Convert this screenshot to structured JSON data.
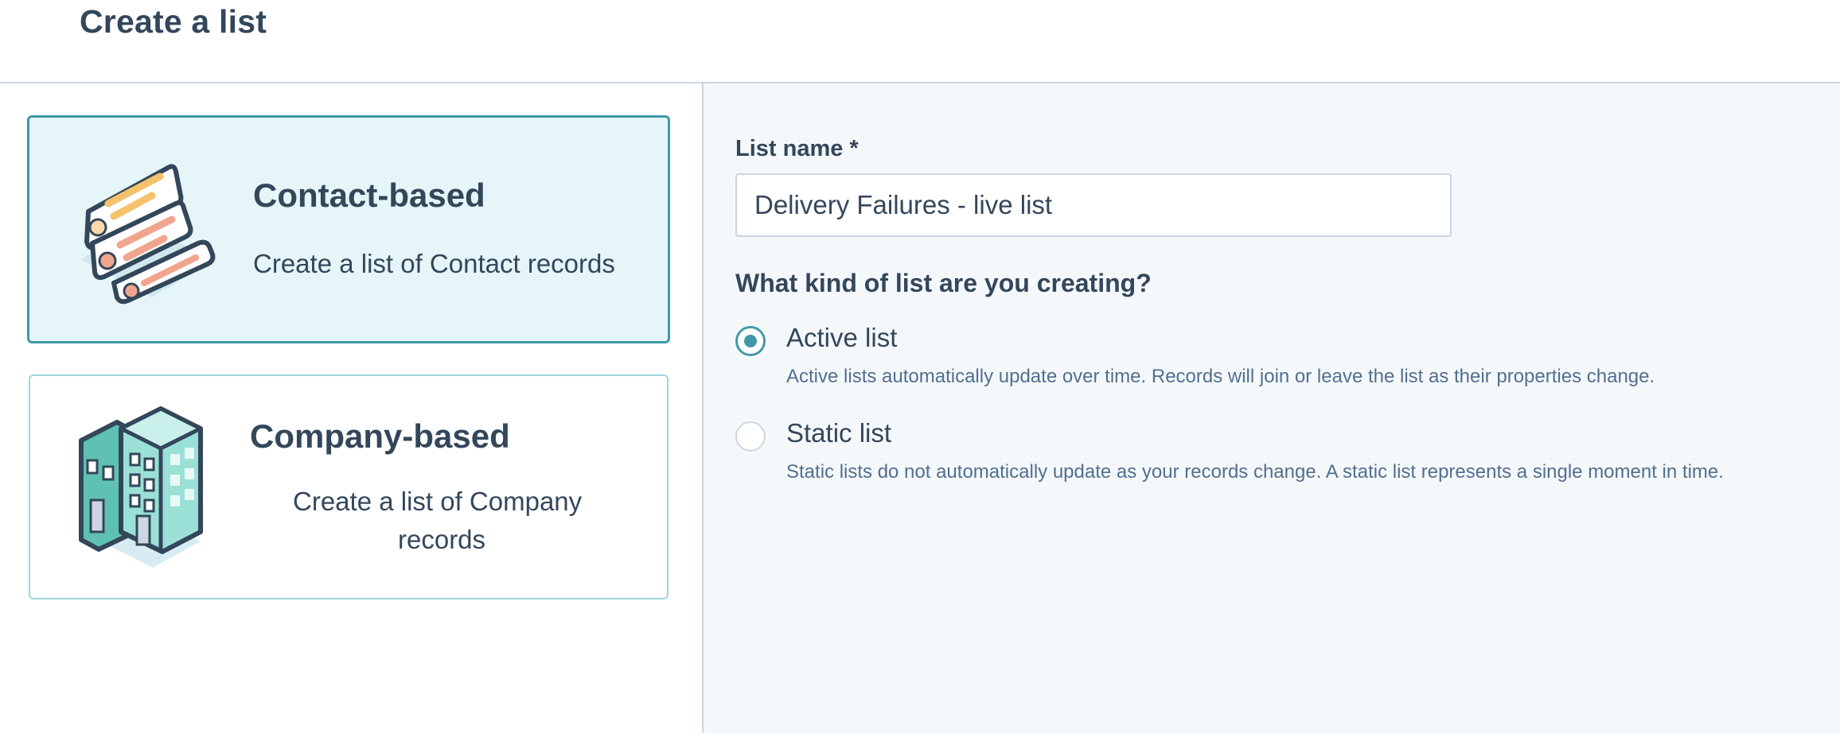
{
  "header": {
    "title": "Create a list"
  },
  "object_types": [
    {
      "title": "Contact-based",
      "description": "Create a list of Contact records",
      "icon": "contact-cards-icon",
      "selected": true
    },
    {
      "title": "Company-based",
      "description_line1": "Create a list of Company",
      "description_line2": "records",
      "icon": "company-building-icon",
      "selected": false
    }
  ],
  "form": {
    "name_label": "List name *",
    "name_value": "Delivery Failures - live list",
    "question": "What kind of list are you creating?",
    "options": [
      {
        "label": "Active list",
        "help": "Active lists automatically update over time. Records will join or leave the list as their properties change.",
        "checked": true
      },
      {
        "label": "Static list",
        "help": "Static lists do not automatically update as your records change. A static list represents a single moment in time.",
        "checked": false
      }
    ]
  },
  "colors": {
    "accent": "#4198a8",
    "text": "#33475b",
    "border": "#cbd6e2",
    "selected_bg": "#e5f5f8"
  }
}
